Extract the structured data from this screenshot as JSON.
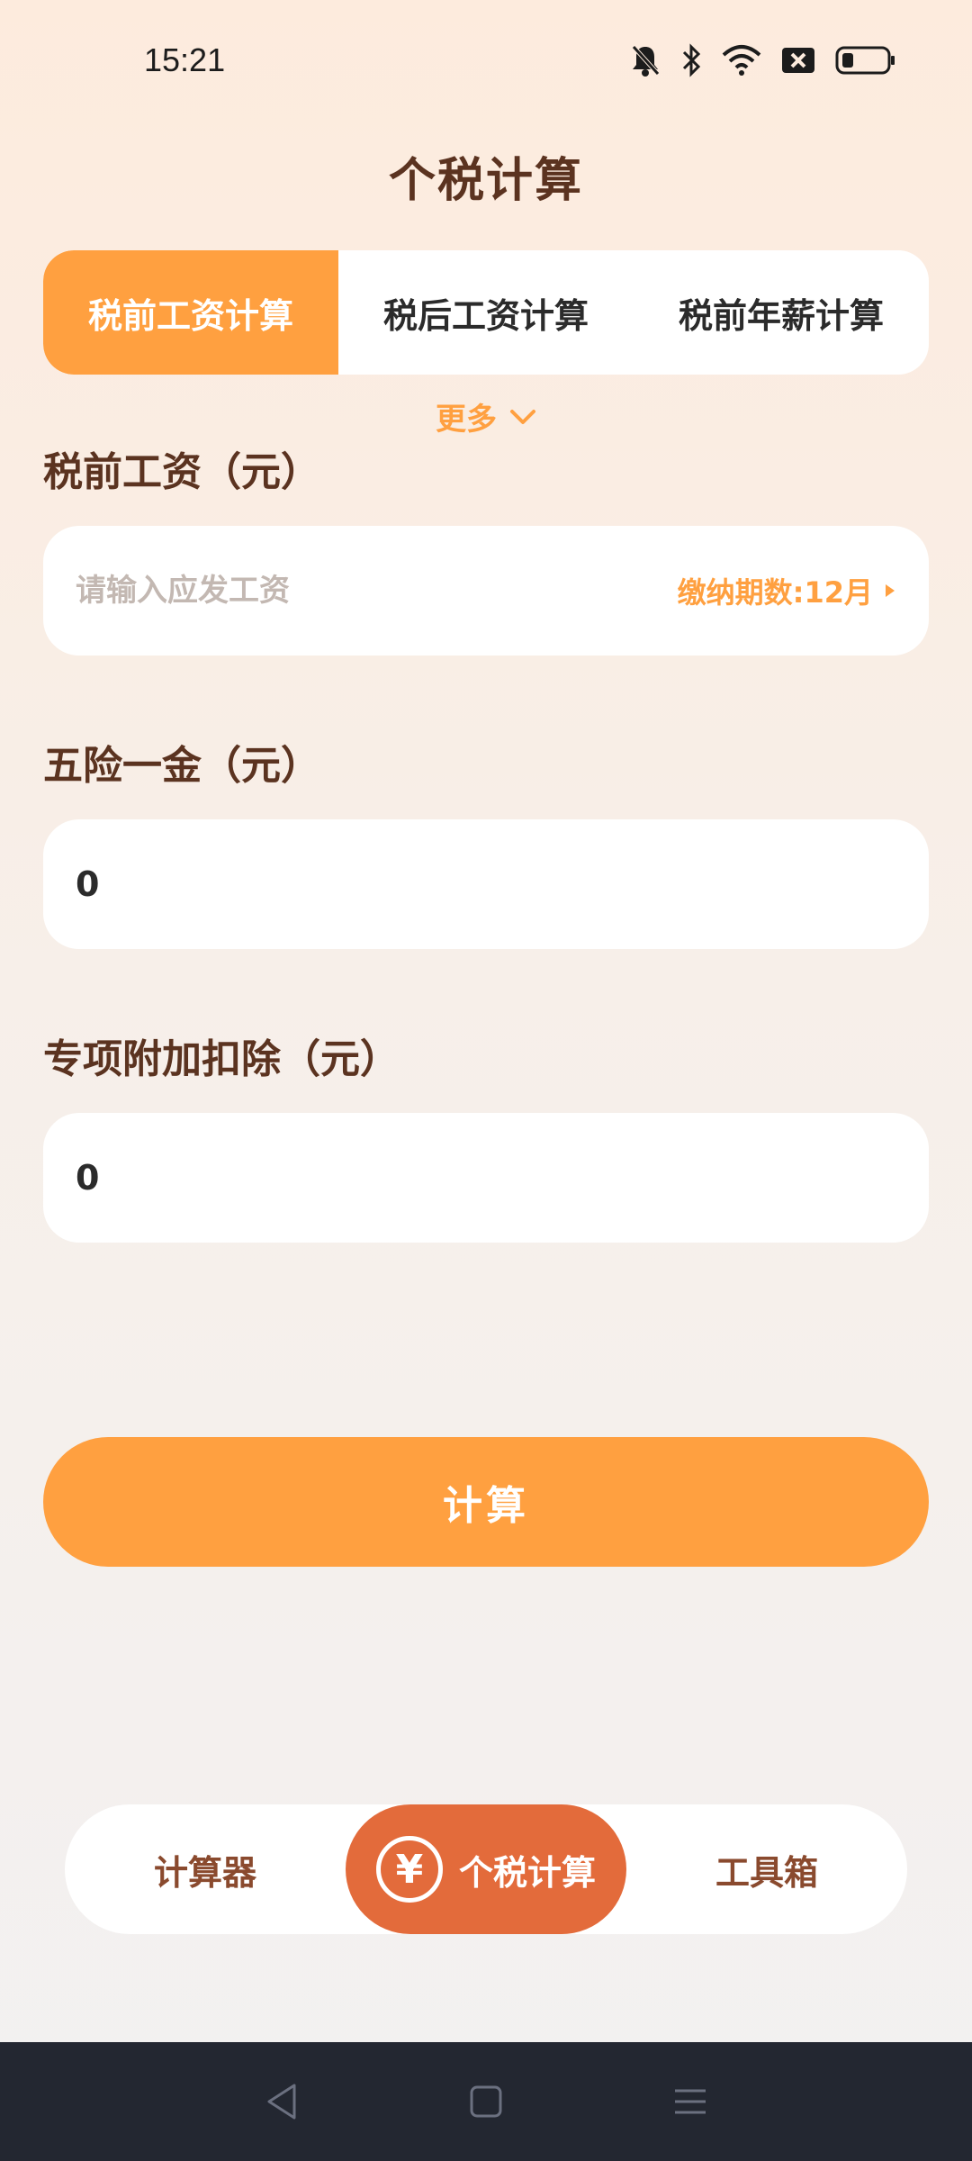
{
  "status_bar": {
    "time": "15:21"
  },
  "page": {
    "title": "个税计算"
  },
  "tabs": [
    {
      "label": "税前工资计算",
      "active": true
    },
    {
      "label": "税后工资计算",
      "active": false
    },
    {
      "label": "税前年薪计算",
      "active": false
    }
  ],
  "more": {
    "label": "更多"
  },
  "fields": {
    "pretax": {
      "label": "税前工资（元）",
      "placeholder": "请输入应发工资",
      "period_label": "缴纳期数:12月"
    },
    "insurance": {
      "label": "五险一金（元）",
      "value": "0"
    },
    "deduction": {
      "label": "专项附加扣除（元）",
      "value": "0"
    }
  },
  "calculate_button": {
    "label": "计算"
  },
  "bottom_nav": [
    {
      "label": "计算器",
      "active": false
    },
    {
      "label": "个税计算",
      "active": true,
      "icon": "yen-icon",
      "icon_glyph": "¥"
    },
    {
      "label": "工具箱",
      "active": false
    }
  ],
  "colors": {
    "accent": "#ffa040",
    "nav_active": "#e36b3b",
    "title": "#5b3320",
    "system_nav": "#232731"
  }
}
